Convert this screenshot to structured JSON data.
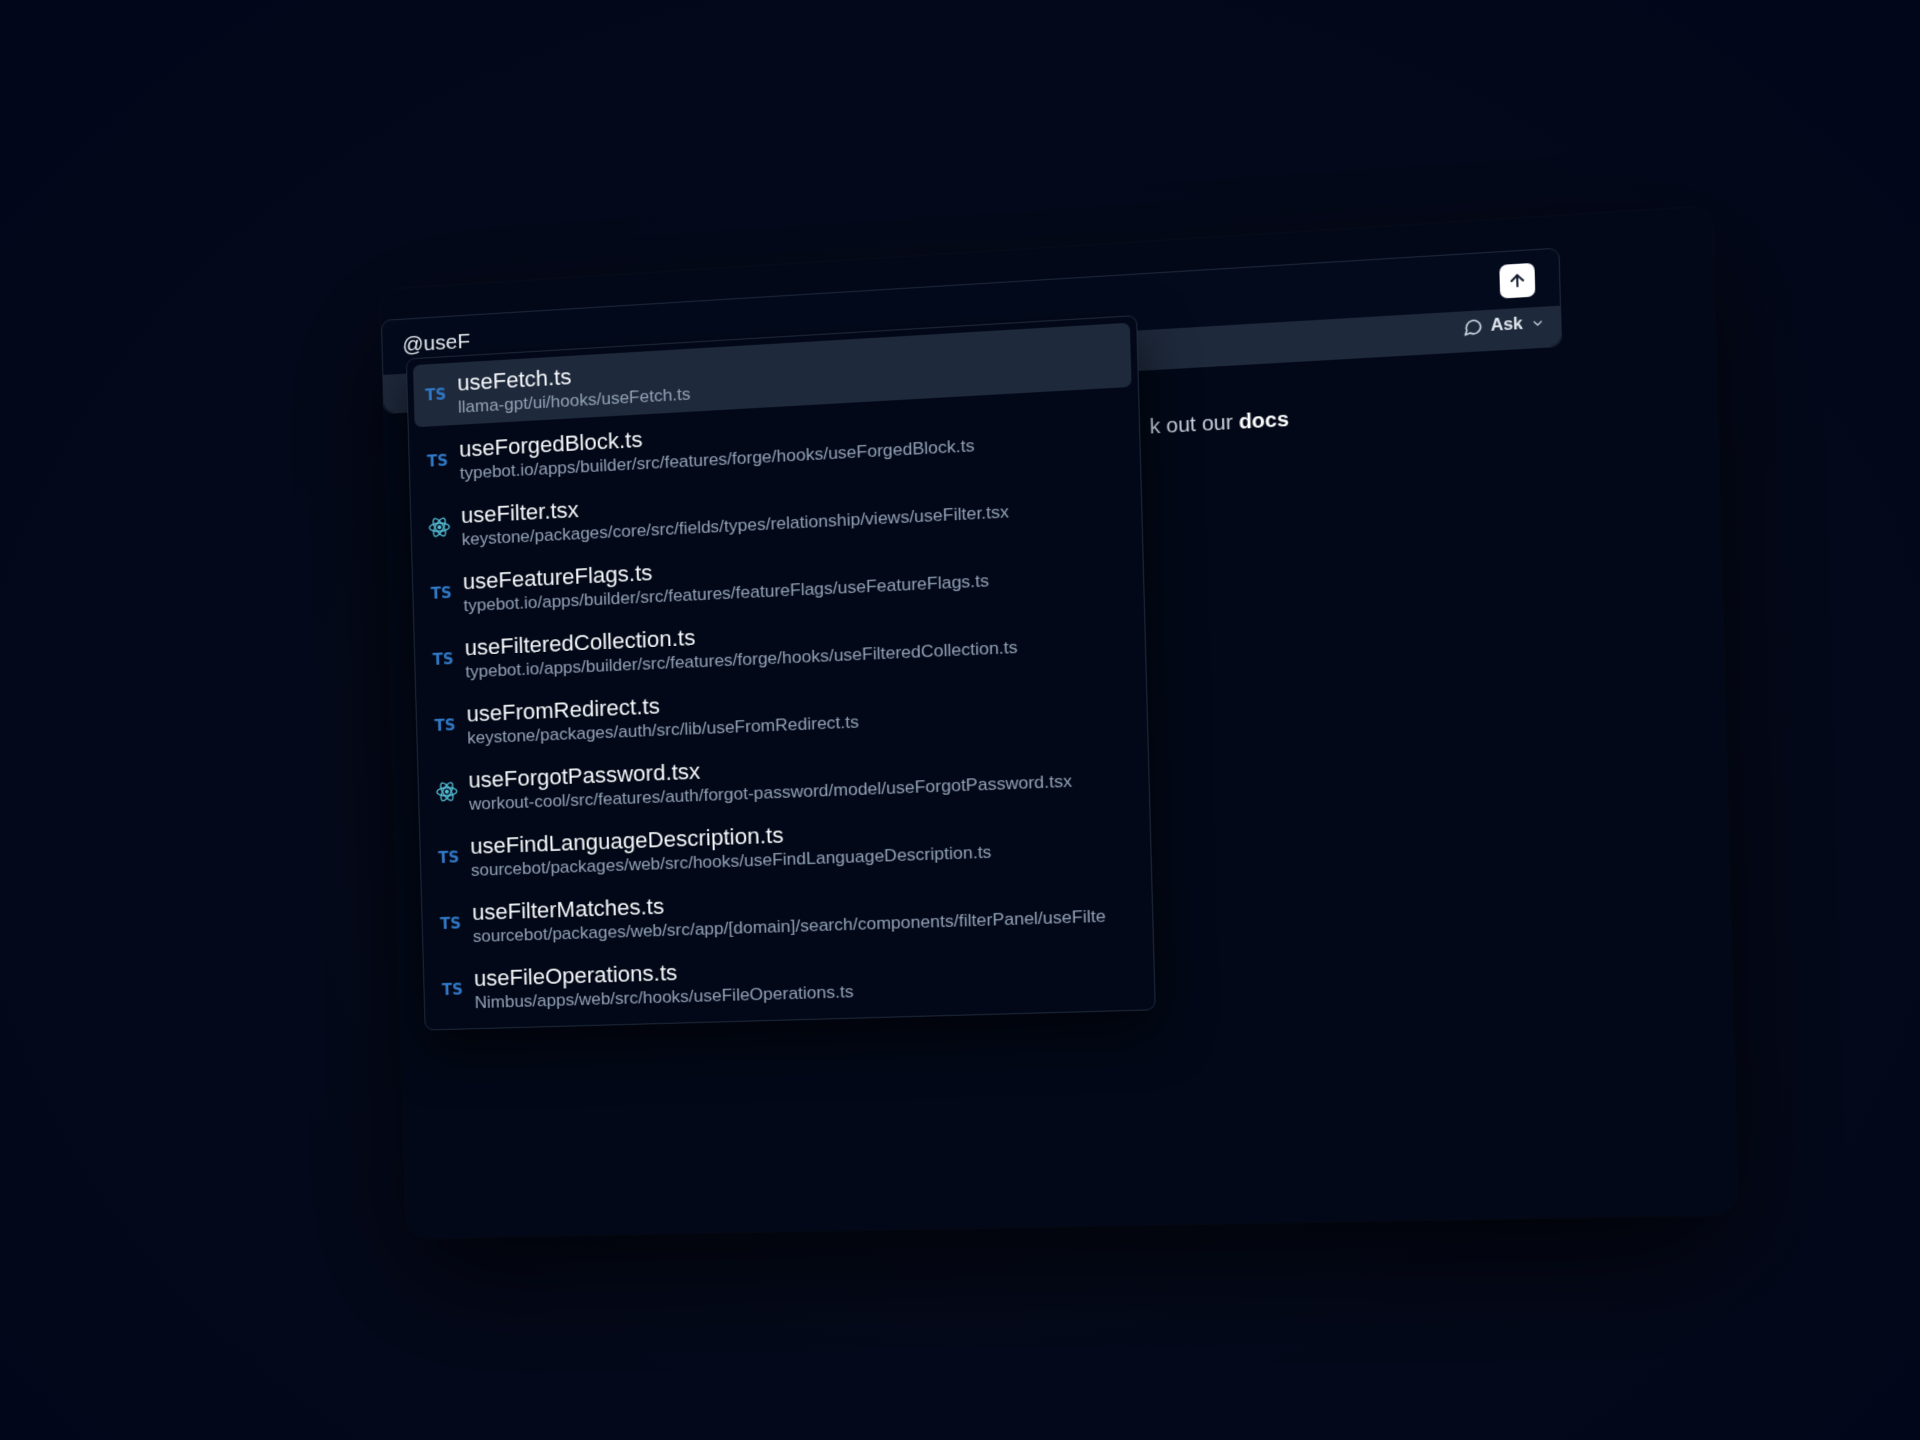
{
  "chat": {
    "input_value": "@useF",
    "mode_label": "Ask",
    "send_icon": "arrow-up-icon",
    "hint_prefix": "k out our ",
    "hint_link": "docs"
  },
  "suggestions": [
    {
      "name": "useFetch.ts",
      "path": "llama-gpt/ui/hooks/useFetch.ts",
      "icon": "ts-icon",
      "icon_label": "TS",
      "selected": true
    },
    {
      "name": "useForgedBlock.ts",
      "path": "typebot.io/apps/builder/src/features/forge/hooks/useForgedBlock.ts",
      "icon": "ts-icon",
      "icon_label": "TS"
    },
    {
      "name": "useFilter.tsx",
      "path": "keystone/packages/core/src/fields/types/relationship/views/useFilter.tsx",
      "icon": "react-icon"
    },
    {
      "name": "useFeatureFlags.ts",
      "path": "typebot.io/apps/builder/src/features/featureFlags/useFeatureFlags.ts",
      "icon": "ts-icon",
      "icon_label": "TS"
    },
    {
      "name": "useFilteredCollection.ts",
      "path": "typebot.io/apps/builder/src/features/forge/hooks/useFilteredCollection.ts",
      "icon": "ts-icon",
      "icon_label": "TS"
    },
    {
      "name": "useFromRedirect.ts",
      "path": "keystone/packages/auth/src/lib/useFromRedirect.ts",
      "icon": "ts-icon",
      "icon_label": "TS"
    },
    {
      "name": "useForgotPassword.tsx",
      "path": "workout-cool/src/features/auth/forgot-password/model/useForgotPassword.tsx",
      "icon": "react-icon"
    },
    {
      "name": "useFindLanguageDescription.ts",
      "path": "sourcebot/packages/web/src/hooks/useFindLanguageDescription.ts",
      "icon": "ts-icon",
      "icon_label": "TS"
    },
    {
      "name": "useFilterMatches.ts",
      "path": "sourcebot/packages/web/src/app/[domain]/search/components/filterPanel/useFilte",
      "icon": "ts-icon",
      "icon_label": "TS"
    },
    {
      "name": "useFileOperations.ts",
      "path": "Nimbus/apps/web/src/hooks/useFileOperations.ts",
      "icon": "ts-icon",
      "icon_label": "TS"
    }
  ],
  "colors": {
    "background": "#03081a",
    "selected_row": "#1e293b",
    "ts_blue": "#3178c6",
    "react_blue": "#58c4dc"
  }
}
